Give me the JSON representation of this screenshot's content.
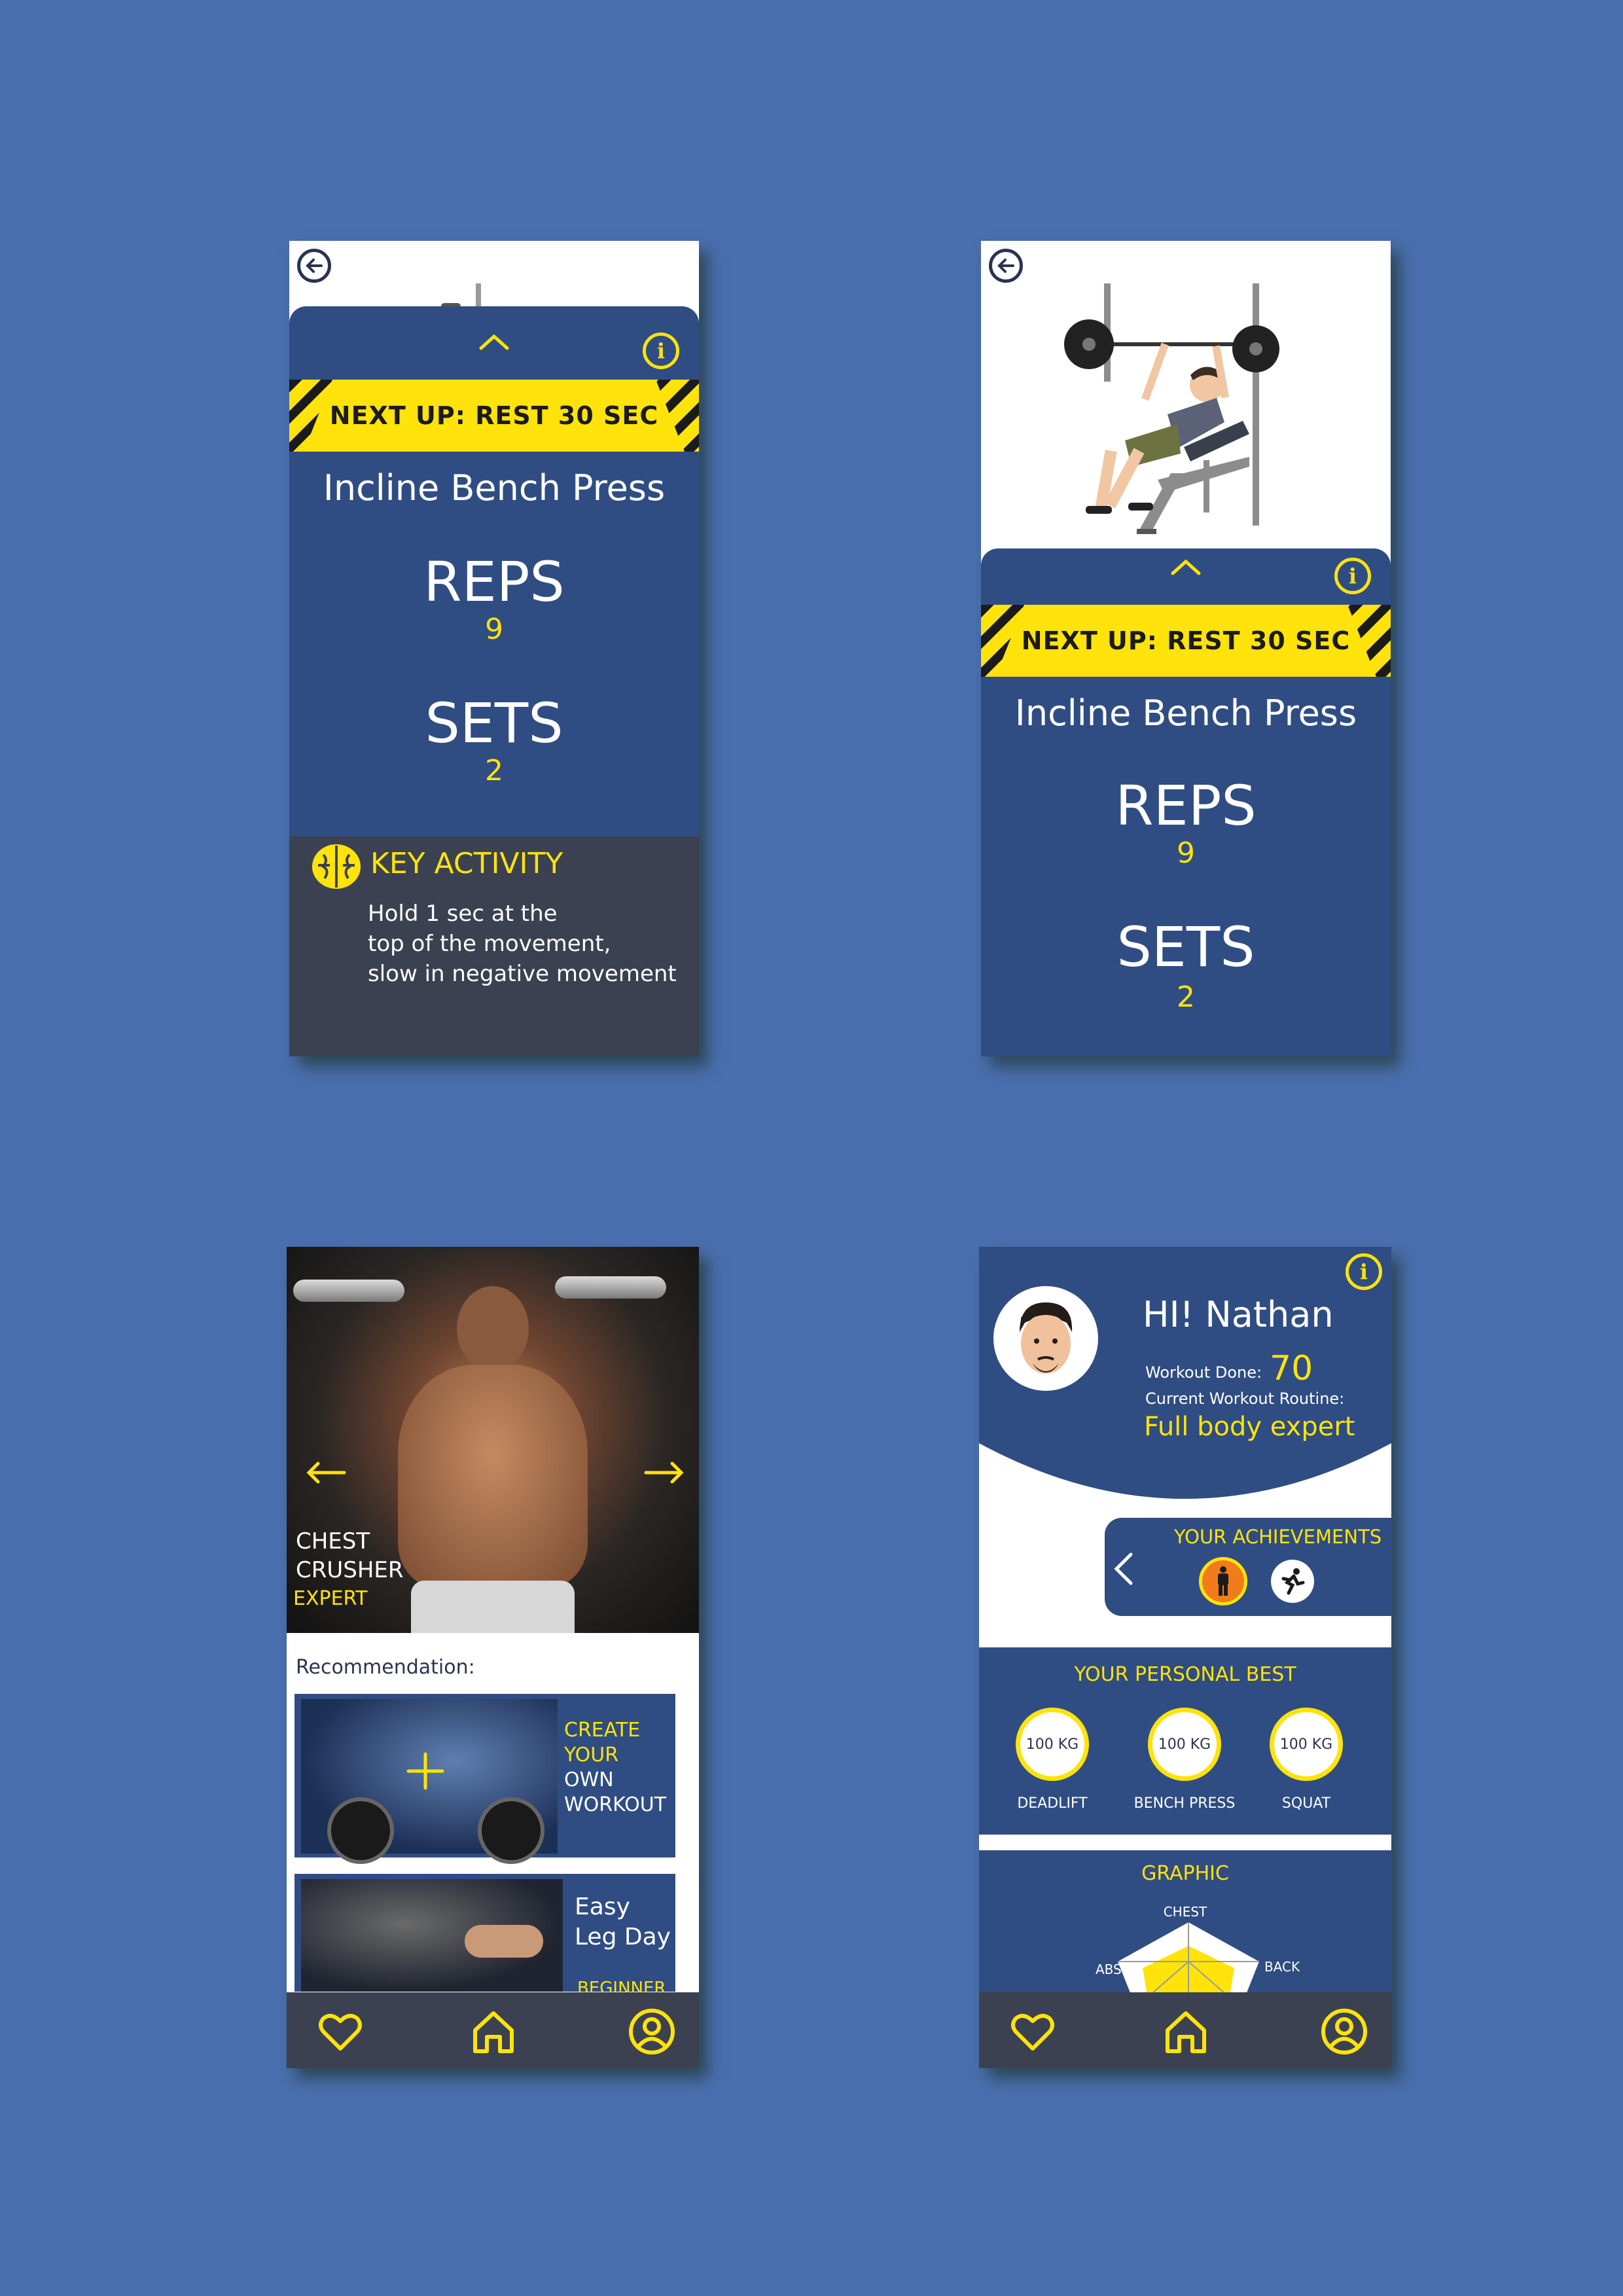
{
  "colors": {
    "background": "#4a6fae",
    "navy": "#2f4d82",
    "accent": "#ffe30b",
    "dark_panel": "#3b4151"
  },
  "workout_screen": {
    "next_up": "NEXT UP: REST 30 SEC",
    "exercise": "Incline Bench Press",
    "reps_label": "REPS",
    "reps_value": "9",
    "sets_label": "SETS",
    "sets_value": "2",
    "key_activity_title": "KEY ACTIVITY",
    "key_activity_lines": [
      "Hold 1 sec at the",
      "top of the movement,",
      "slow in negative movement"
    ]
  },
  "home_screen": {
    "hero_title_line1": "CHEST",
    "hero_title_line2": "CRUSHER",
    "hero_level": "EXPERT",
    "recommendation_label": "Recommendation:",
    "card1_lines": [
      "CREATE",
      "YOUR",
      "OWN",
      "WORKOUT"
    ],
    "card2_title_line1": "Easy",
    "card2_title_line2": "Leg Day",
    "card2_level": "BEGINNER"
  },
  "profile_screen": {
    "greeting": "HI! Nathan",
    "workout_done_label": "Workout Done:",
    "workout_done_value": "70",
    "routine_label": "Current Workout Routine:",
    "routine_value": "Full body expert",
    "achievements_title": "YOUR ACHIEVEMENTS",
    "personal_best_title": "YOUR PERSONAL BEST",
    "personal_bests": [
      {
        "value": "100 KG",
        "label": "DEADLIFT"
      },
      {
        "value": "100 KG",
        "label": "BENCH PRESS"
      },
      {
        "value": "100 KG",
        "label": "SQUAT"
      }
    ],
    "graphic_title": "GRAPHIC",
    "graphic_labels": {
      "top": "CHEST",
      "left": "ABS",
      "right": "BACK"
    }
  }
}
